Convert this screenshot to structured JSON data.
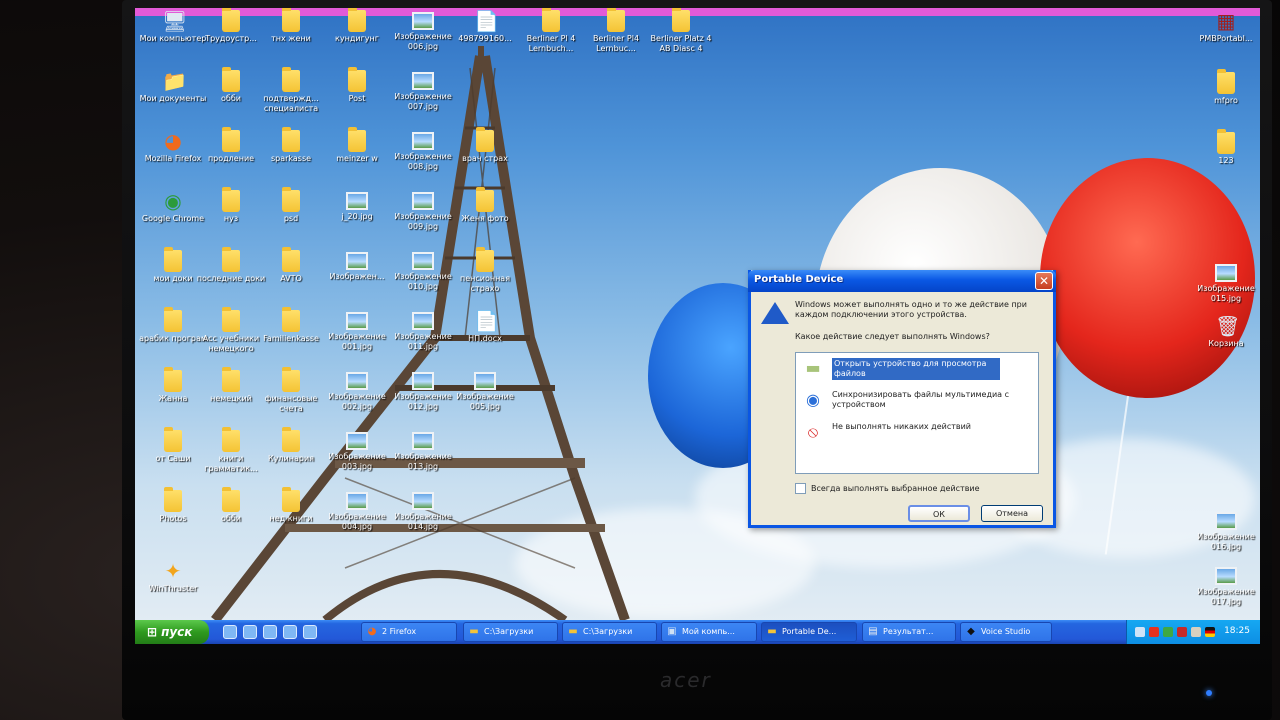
{
  "desktop_icons": [
    {
      "label": "Мои компьютер",
      "kind": "computer",
      "icon": "computer-icon"
    },
    {
      "label": "Трудоустр...",
      "kind": "folder"
    },
    {
      "label": "тнх жени",
      "kind": "folder"
    },
    {
      "label": "кундигунг",
      "kind": "folder"
    },
    {
      "label": "Изображение 006.jpg",
      "kind": "image"
    },
    {
      "label": "498799160...",
      "kind": "doc",
      "icon": "word-doc-icon"
    },
    {
      "label": "Berliner Pl 4 Lernbuch...",
      "kind": "folder"
    },
    {
      "label": "Berliner Pl4 Lernbuc...",
      "kind": "folder"
    },
    {
      "label": "Berliner Platz 4 AB Diasc 4",
      "kind": "folder"
    },
    {
      "label": "PMBPortabl...",
      "kind": "app",
      "icon": "archive-icon"
    },
    {
      "label": "Мои документы",
      "kind": "docs",
      "icon": "my-documents-icon"
    },
    {
      "label": "обби",
      "kind": "folder"
    },
    {
      "label": "подтвержд... специалиста",
      "kind": "folder"
    },
    {
      "label": "Post",
      "kind": "folder"
    },
    {
      "label": "Изображение 007.jpg",
      "kind": "image"
    },
    {
      "label": "mfpro",
      "kind": "folder"
    },
    {
      "label": "Mozilla Firefox",
      "kind": "app",
      "icon": "firefox-icon"
    },
    {
      "label": "продление",
      "kind": "folder"
    },
    {
      "label": "sparkasse",
      "kind": "folder"
    },
    {
      "label": "meinzer w",
      "kind": "folder"
    },
    {
      "label": "Изображение 008.jpg",
      "kind": "image"
    },
    {
      "label": "врач страх",
      "kind": "folder"
    },
    {
      "label": "123",
      "kind": "folder"
    },
    {
      "label": "Google Chrome",
      "kind": "app",
      "icon": "chrome-icon"
    },
    {
      "label": "нуз",
      "kind": "folder"
    },
    {
      "label": "psd",
      "kind": "folder"
    },
    {
      "label": "j_20.jpg",
      "kind": "image"
    },
    {
      "label": "Изображение 009.jpg",
      "kind": "image"
    },
    {
      "label": "Женя фото",
      "kind": "folder"
    },
    {
      "label": "мои доки",
      "kind": "folder"
    },
    {
      "label": "последние доки",
      "kind": "folder"
    },
    {
      "label": "AVTO",
      "kind": "folder"
    },
    {
      "label": "Изображен...",
      "kind": "image"
    },
    {
      "label": "Изображение 010.jpg",
      "kind": "image"
    },
    {
      "label": "пенсионная страхо",
      "kind": "folder"
    },
    {
      "label": "Изображение 015.jpg",
      "kind": "image"
    },
    {
      "label": "арабик програм",
      "kind": "folder"
    },
    {
      "label": "Acc учебники немецкого",
      "kind": "folder"
    },
    {
      "label": "Familienkasse",
      "kind": "folder"
    },
    {
      "label": "Изображение 001.jpg",
      "kind": "image"
    },
    {
      "label": "Изображение 011.jpg",
      "kind": "image"
    },
    {
      "label": "НП.docx",
      "kind": "doc",
      "icon": "word-doc-icon"
    },
    {
      "label": "Корзина",
      "kind": "recycle",
      "icon": "recycle-bin-icon"
    },
    {
      "label": "Жанна",
      "kind": "folder"
    },
    {
      "label": "немецкий",
      "kind": "folder"
    },
    {
      "label": "финансовые счета",
      "kind": "folder"
    },
    {
      "label": "Изображение 002.jpg",
      "kind": "image"
    },
    {
      "label": "Изображение 012.jpg",
      "kind": "image"
    },
    {
      "label": "Изображение 005.jpg",
      "kind": "image"
    },
    {
      "label": "от Саши",
      "kind": "folder"
    },
    {
      "label": "книги грамматик...",
      "kind": "folder"
    },
    {
      "label": "Кулинария",
      "kind": "folder"
    },
    {
      "label": "Изображение 003.jpg",
      "kind": "image"
    },
    {
      "label": "Изображение 013.jpg",
      "kind": "image"
    },
    {
      "label": "Photos",
      "kind": "folder"
    },
    {
      "label": "обби",
      "kind": "folder"
    },
    {
      "label": "нед книги",
      "kind": "folder"
    },
    {
      "label": "Изображение 004.jpg",
      "kind": "image"
    },
    {
      "label": "Изображение 014.jpg",
      "kind": "image"
    },
    {
      "label": "Изображение 016.jpg",
      "kind": "image"
    },
    {
      "label": "WinThruster",
      "kind": "app",
      "icon": "winthruster-icon"
    },
    {
      "label": "Изображение 017.jpg",
      "kind": "image"
    }
  ],
  "dialog": {
    "title": "Portable Device",
    "message": "Windows может выполнять одно и то же действие при каждом подключении этого устройства.",
    "question": "Какое действие следует выполнять Windows?",
    "options": [
      {
        "label": "Открыть устройство для просмотра файлов",
        "icon": "folder-icon",
        "selected": true
      },
      {
        "label": "Синхронизировать файлы мультимедиа с устройством",
        "icon": "media-sync-icon",
        "selected": false
      },
      {
        "label": "Не выполнять никаких действий",
        "icon": "no-action-icon",
        "selected": false
      }
    ],
    "always_label": "Всегда выполнять выбранное действие",
    "ok_label": "ОК",
    "cancel_label": "Отмена",
    "close_glyph": "✕"
  },
  "taskbar": {
    "start_label": "пуск",
    "tasks": [
      {
        "label": "2 Firefox",
        "icon": "firefox-icon"
      },
      {
        "label": "C:\\Загрузки",
        "icon": "folder-icon"
      },
      {
        "label": "C:\\Загрузки",
        "icon": "folder-icon"
      },
      {
        "label": "Мой компь...",
        "icon": "computer-icon"
      },
      {
        "label": "Portable De...",
        "icon": "folder-icon",
        "active": true
      },
      {
        "label": "Результат...",
        "icon": "document-icon"
      },
      {
        "label": "Voice Studio",
        "icon": "voice-studio-icon"
      }
    ],
    "clock": "18:25"
  },
  "bezel": {
    "brand": "acer"
  },
  "colors": {
    "xp_blue": "#0a58e4",
    "start_green": "#2f9a1f",
    "selection": "#316ac5"
  }
}
